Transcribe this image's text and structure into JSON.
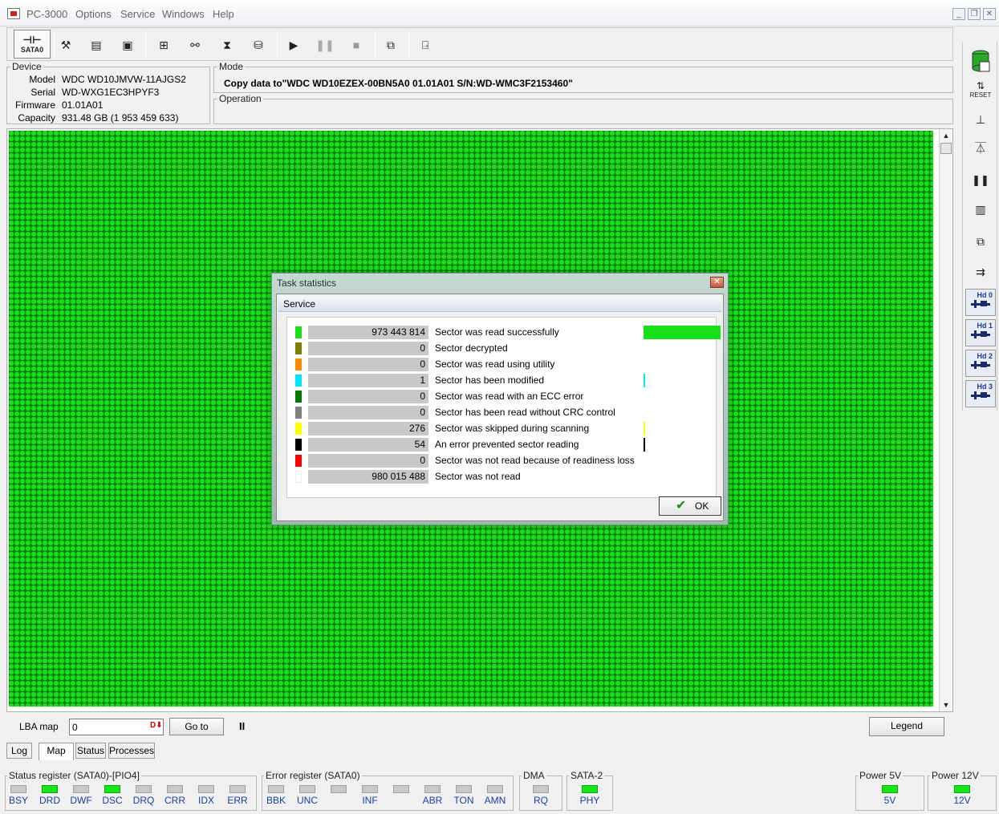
{
  "window": {
    "title": "PC-3000",
    "menu": [
      "Options",
      "Service",
      "Windows",
      "Help"
    ],
    "controls": [
      "minimize",
      "restore",
      "close"
    ]
  },
  "toolbar": {
    "sata_label": "SATA0",
    "icons": [
      "sata-port-icon",
      "tools-icon",
      "memory-chip-icon",
      "percent-chip-icon",
      "tree-icon",
      "binoculars-icon",
      "flash-icon",
      "disk-read-icon",
      "play-icon",
      "pause-icon",
      "stop-icon",
      "copy-windows-icon",
      "exit-icon"
    ]
  },
  "device": {
    "title": "Device",
    "fields": [
      {
        "label": "Model",
        "value": "WDC WD10JMVW-11AJGS2"
      },
      {
        "label": "Serial",
        "value": "WD-WXG1EC3HPYF3"
      },
      {
        "label": "Firmware",
        "value": "01.01A01"
      },
      {
        "label": "Capacity",
        "value": "931.48 GB (1 953 459 633)"
      }
    ]
  },
  "mode": {
    "title": "Mode",
    "text": "Copy data to\"WDC WD10EZEX-00BN5A0 01.01A01 S/N:WD-WMC3F2153460\""
  },
  "operation": {
    "title": "Operation"
  },
  "right_toolbar": {
    "icons": [
      "database-icon",
      "reset-icon",
      "connect-icon",
      "voltage-icon",
      "pause-icon",
      "lba-icon",
      "copy-icon",
      "cable-icon"
    ],
    "reset_label": "RESET",
    "hd_buttons": [
      "Hd 0",
      "Hd 1",
      "Hd 2",
      "Hd 3"
    ]
  },
  "lba": {
    "label": "LBA map",
    "value": "0",
    "goto_label": "Go to",
    "pause_symbol": "II",
    "legend_label": "Legend"
  },
  "tabs": [
    "Log",
    "Map",
    "Status",
    "Processes"
  ],
  "active_tab": "Map",
  "status_register": {
    "title": "Status register (SATA0)-[PIO4]",
    "bits": [
      {
        "label": "BSY",
        "on": false
      },
      {
        "label": "DRD",
        "on": true
      },
      {
        "label": "DWF",
        "on": false
      },
      {
        "label": "DSC",
        "on": true
      },
      {
        "label": "DRQ",
        "on": false
      },
      {
        "label": "CRR",
        "on": false
      },
      {
        "label": "IDX",
        "on": false
      },
      {
        "label": "ERR",
        "on": false
      }
    ]
  },
  "error_register": {
    "title": "Error register (SATA0)",
    "bits": [
      {
        "label": "BBK",
        "on": false
      },
      {
        "label": "UNC",
        "on": false
      },
      {
        "label": "",
        "on": false
      },
      {
        "label": "INF",
        "on": false
      },
      {
        "label": "",
        "on": false
      },
      {
        "label": "ABR",
        "on": false
      },
      {
        "label": "TON",
        "on": false
      },
      {
        "label": "AMN",
        "on": false
      }
    ]
  },
  "dma": {
    "title": "DMA",
    "label": "RQ",
    "on": false
  },
  "sata2": {
    "title": "SATA-2",
    "label": "PHY",
    "on": true
  },
  "power5": {
    "title": "Power 5V",
    "label": "5V",
    "on": true
  },
  "power12": {
    "title": "Power 12V",
    "label": "12V",
    "on": true
  },
  "dialog": {
    "title": "Task statistics",
    "section": "Service",
    "ok_label": "OK",
    "rows": [
      {
        "count": "973 443 814",
        "desc": "Sector was read successfully",
        "color": "#18e018",
        "bar_fraction": 0.498
      },
      {
        "count": "0",
        "desc": "Sector decrypted",
        "color": "#808000",
        "bar_fraction": 0
      },
      {
        "count": "0",
        "desc": "Sector was read using utility",
        "color": "#ff8c00",
        "bar_fraction": 0
      },
      {
        "count": "1",
        "desc": "Sector has been modified",
        "color": "#00e5ff",
        "bar_fraction": 1e-07
      },
      {
        "count": "0",
        "desc": "Sector was read with an ECC error",
        "color": "#007a00",
        "bar_fraction": 0
      },
      {
        "count": "0",
        "desc": "Sector has been read without CRC control",
        "color": "#808080",
        "bar_fraction": 0
      },
      {
        "count": "276",
        "desc": "Sector was skipped during scanning",
        "color": "#ffff00",
        "bar_fraction": 1e-07
      },
      {
        "count": "54",
        "desc": "An error prevented sector reading",
        "color": "#000000",
        "bar_fraction": 1e-07
      },
      {
        "count": "0",
        "desc": "Sector was not read because of readiness loss",
        "color": "#ff0000",
        "bar_fraction": 0
      },
      {
        "count": "980 015 488",
        "desc": "Sector was not read",
        "color": "#ffffff",
        "bar_fraction": 0
      }
    ]
  }
}
